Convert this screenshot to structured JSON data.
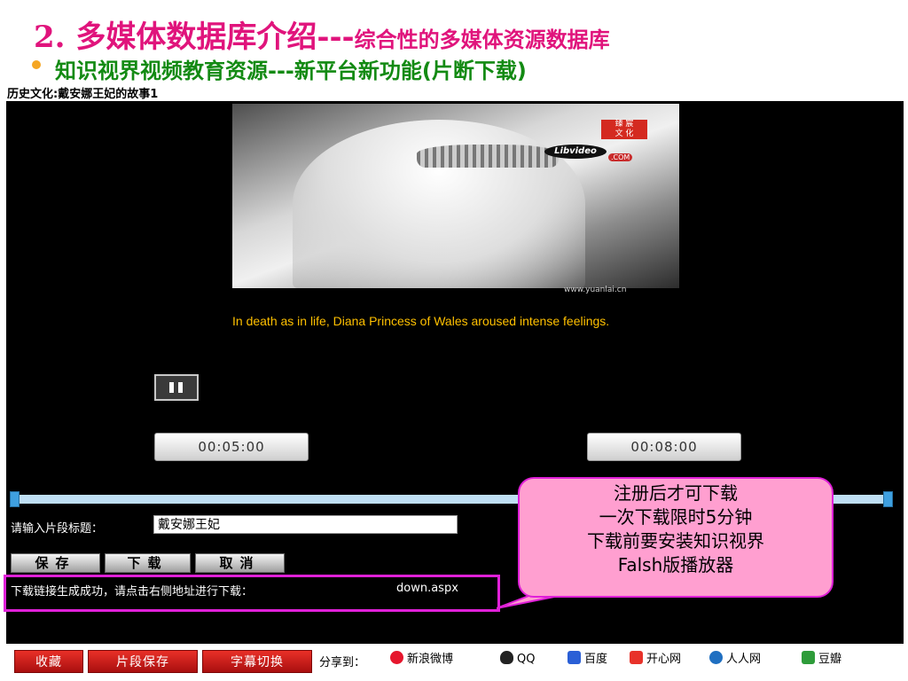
{
  "slide": {
    "title_main": "2. 多媒体数据库介绍---",
    "title_sub": "综合性的多媒体资源数据库",
    "subtitle": "知识视界视频教育资源---新平台新功能(片断下载)"
  },
  "page": {
    "heading": "历史文化:戴安娜王妃的故事1"
  },
  "video": {
    "badge": "臻 宸\n文 化",
    "logo": "Libvideo",
    "logo_suffix": ".COM",
    "watermark": "www.yuanlai.cn",
    "caption": "In death as in life, Diana Princess of Wales aroused intense feelings."
  },
  "player": {
    "start_time": "00:05:00",
    "end_time": "00:08:00"
  },
  "clip": {
    "label": "请输入片段标题：",
    "value": "戴安娜王妃"
  },
  "actions": {
    "save": "保存",
    "download": "下载",
    "cancel": "取消"
  },
  "status": {
    "message": "下载链接生成成功，请点击右侧地址进行下载：",
    "link": "down.aspx"
  },
  "callout": {
    "line1": "注册后才可下载",
    "line2": "一次下载限时5分钟",
    "line3": "下载前要安装知识视界",
    "line4": "Falsh版播放器"
  },
  "bottom": {
    "favorite": "收藏",
    "save_clip": "片段保存",
    "subtitle_switch": "字幕切换",
    "share_label": "分享到：",
    "share": [
      {
        "name": "新浪微博",
        "icon": "weibo-icon",
        "color": "#e6162d"
      },
      {
        "name": "QQ",
        "icon": "qq-icon",
        "color": "#222222"
      },
      {
        "name": "百度",
        "icon": "baidu-icon",
        "color": "#2a5fd6"
      },
      {
        "name": "开心网",
        "icon": "kaixin-icon",
        "color": "#e8322a"
      },
      {
        "name": "人人网",
        "icon": "renren-icon",
        "color": "#1f6fc1"
      },
      {
        "name": "豆瓣",
        "icon": "douban-icon",
        "color": "#2e9c3a"
      }
    ]
  },
  "colors": {
    "title": "#e0147c",
    "subtitle": "#138a13",
    "caption": "#ffc000",
    "highlight": "#e020d8",
    "callout_bg": "#ff9fd0",
    "timeline": "#bfdff4"
  }
}
